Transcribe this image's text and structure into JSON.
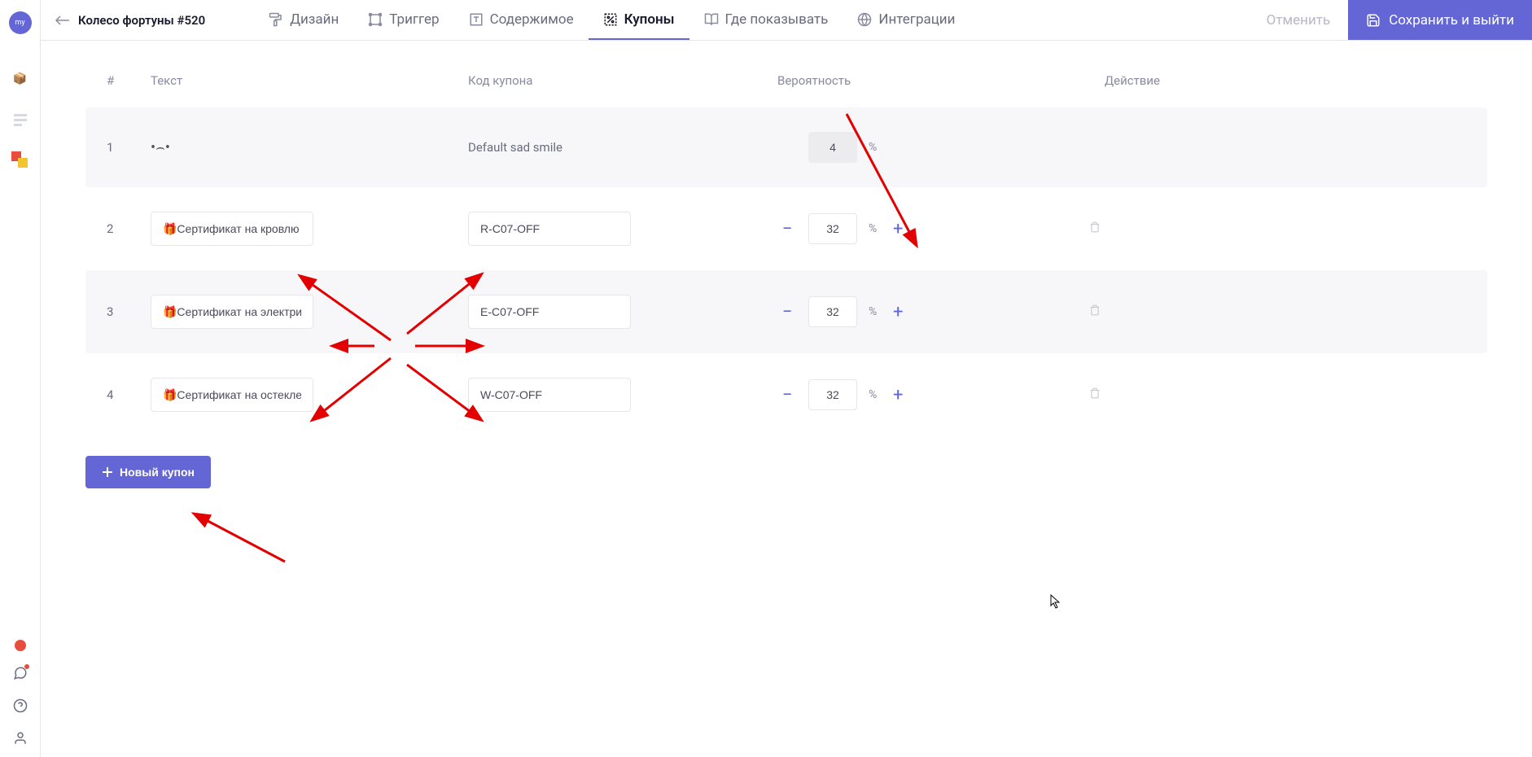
{
  "sidebar": {
    "logo_text": "my"
  },
  "topbar": {
    "page_title": "Колесо фортуны #520",
    "tabs": [
      {
        "label": "Дизайн"
      },
      {
        "label": "Триггер"
      },
      {
        "label": "Содержимое"
      },
      {
        "label": "Купоны"
      },
      {
        "label": "Где показывать"
      },
      {
        "label": "Интеграции"
      }
    ],
    "cancel_label": "Отменить",
    "save_label": "Сохранить и выйти"
  },
  "table": {
    "headers": {
      "number": "#",
      "text": "Текст",
      "code": "Код купона",
      "probability": "Вероятность",
      "action": "Действие"
    },
    "rows": [
      {
        "num": "1",
        "text_static": "Default sad smile",
        "prob": "4",
        "readonly": true
      },
      {
        "num": "2",
        "text": "🎁Сертификат на кровлю",
        "code": "R-C07-OFF",
        "prob": "32"
      },
      {
        "num": "3",
        "text": "🎁Сертификат на электрику",
        "code": "E-C07-OFF",
        "prob": "32"
      },
      {
        "num": "4",
        "text": "🎁Сертификат на остеклени",
        "code": "W-C07-OFF",
        "prob": "32"
      }
    ],
    "percent": "%"
  },
  "new_coupon_label": "Новый купон"
}
